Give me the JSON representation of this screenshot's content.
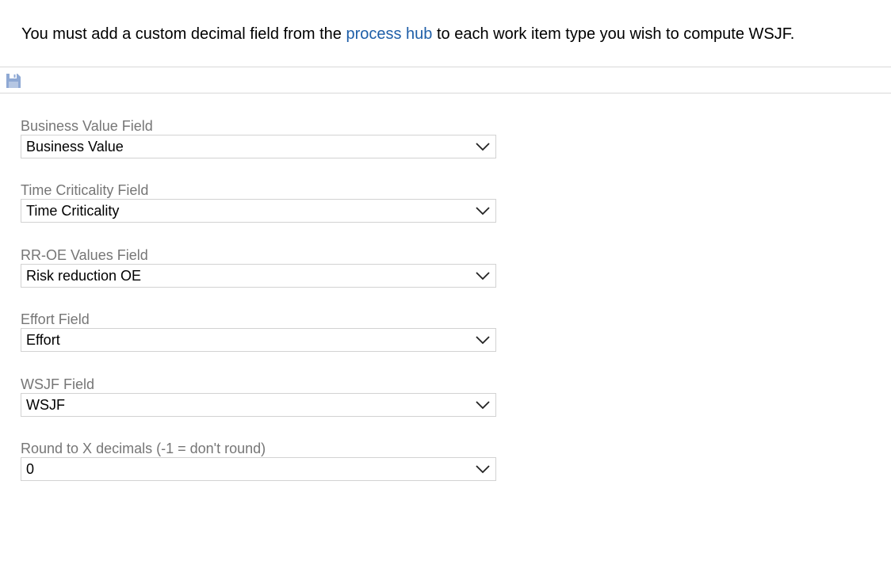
{
  "intro": {
    "before_link": "You must add a custom decimal field from the ",
    "link_text": "process hub",
    "after_link": " to each work item type you wish to compute WSJF."
  },
  "toolbar": {
    "save_icon": "save-icon"
  },
  "fields": [
    {
      "label": "Business Value Field",
      "value": "Business Value"
    },
    {
      "label": "Time Criticality Field",
      "value": "Time Criticality"
    },
    {
      "label": "RR-OE Values Field",
      "value": "Risk reduction OE"
    },
    {
      "label": "Effort Field",
      "value": "Effort"
    },
    {
      "label": "WSJF Field",
      "value": "WSJF"
    },
    {
      "label": "Round to X decimals (-1 = don't round)",
      "value": "0"
    }
  ],
  "colors": {
    "link": "#1f5fa8",
    "label": "#767676",
    "save_icon": "#8fa9d4",
    "border": "#d2d2d2"
  }
}
